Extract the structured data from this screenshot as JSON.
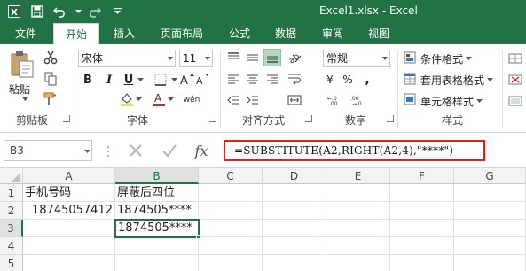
{
  "window": {
    "title": "Excel1.xlsx - Excel"
  },
  "ribbon_tabs": [
    "文件",
    "开始",
    "插入",
    "页面布局",
    "公式",
    "数据",
    "审阅",
    "视图"
  ],
  "clipboard": {
    "paste_label": "粘贴",
    "group_label": "剪贴板"
  },
  "font": {
    "name": "宋体",
    "size": "11",
    "group_label": "字体",
    "bold": "B",
    "italic": "I",
    "underline": "U",
    "wen": "wén"
  },
  "alignment": {
    "group_label": "对齐方式"
  },
  "number": {
    "format": "常规",
    "group_label": "数字",
    "currency": "¥",
    "percent": "%",
    "comma": ","
  },
  "styles": {
    "conditional": "条件格式",
    "table_format": "套用表格格式",
    "cell_styles": "单元格样式",
    "group_label": "样式"
  },
  "formula_bar": {
    "name_box": "B3",
    "fx": "fx",
    "formula": "=SUBSTITUTE(A2,RIGHT(A2,4),\"****\")"
  },
  "sheet": {
    "columns": [
      "A",
      "B",
      "C",
      "D",
      "E",
      "F",
      "G"
    ],
    "rows": [
      "1",
      "2",
      "3",
      "4",
      "5"
    ],
    "cells": {
      "A1": "手机号码",
      "B1": "屏蔽后四位",
      "A2": "18745057412",
      "B2": "1874505****",
      "B3": "1874505****"
    },
    "active_cell": "B3"
  },
  "colors": {
    "accent": "#217346",
    "highlight": "#e0201c"
  }
}
